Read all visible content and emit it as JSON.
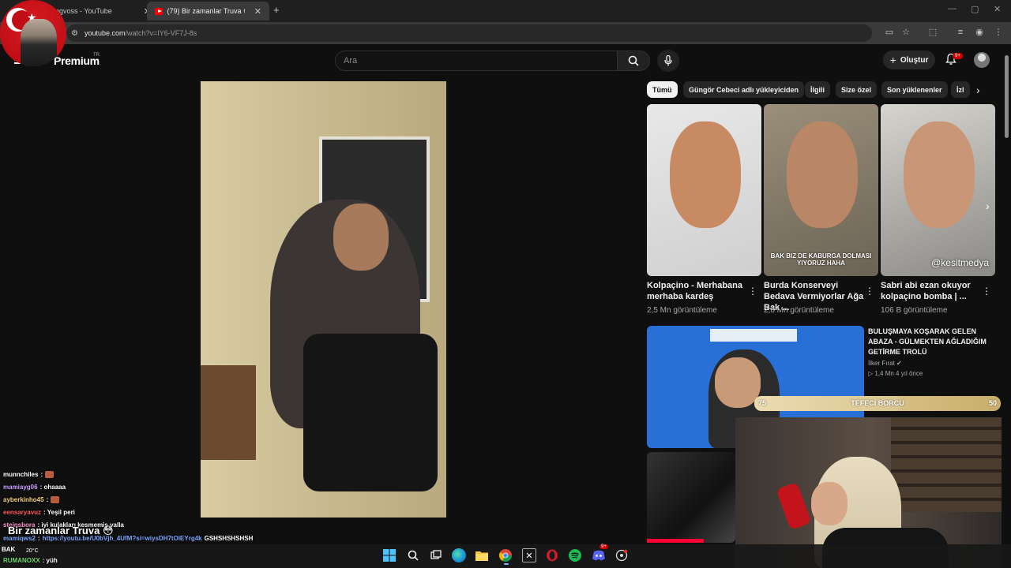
{
  "browser": {
    "tabs": [
      {
        "title": "ngvoss - YouTube",
        "active": false
      },
      {
        "title": "(79) Bir zamanlar Truva 😳 - Yo",
        "active": true
      }
    ],
    "new_tab": "+",
    "close": "✕",
    "window_controls": [
      "—",
      "▢",
      "✕"
    ],
    "url_host": "youtube.com",
    "url_path": "/watch?v=IY6-VF7J-8s"
  },
  "youtube": {
    "logo_text": "Premium",
    "logo_region": "TR",
    "search_placeholder": "Ara",
    "create_label": "Oluştur",
    "notification_badge": "9+"
  },
  "chips": [
    "Tümü",
    "Güngör Cebeci adlı yükleyiciden",
    "İlgili",
    "Size özel",
    "Son yüklenenler",
    "İzl"
  ],
  "shorts": [
    {
      "title": "Kolpaçino - Merhabana merhaba kardeş",
      "views": "2,5 Mn görüntüleme",
      "caption": "",
      "watermark": ""
    },
    {
      "title": "Burda Konserveyi Bedava Vermiyorlar Ağa Bak ...",
      "views": "2,8 Mn görüntüleme",
      "caption": "BAK BIZ DE KABURGA DOLMASI YIYORUZ HAHA",
      "watermark": ""
    },
    {
      "title": "Sabri abi ezan okuyor kolpaçino bomba | ...",
      "views": "106 B görüntüleme",
      "caption": "",
      "watermark": "@kesitmedya"
    }
  ],
  "recommendation": {
    "title": "BULUŞMAYA KOŞARAK GELEN ABAZA - GÜLMEKTEN AĞLADIĞIM GETİRME TROLÜ",
    "channel": "İlker Fırat",
    "meta": "1,4 Mn   4 yıl önce"
  },
  "stream_bar": {
    "left": "75",
    "label": "TEFECİ BORCU",
    "right": "50",
    "progress": 0.6
  },
  "chat": [
    {
      "user": "munnchiles",
      "user_color": "#ffffff",
      "message": "",
      "emote": true
    },
    {
      "user": "mamiayg06",
      "user_color": "#c9a0ff",
      "message": ": ohaaaa",
      "emote": false
    },
    {
      "user": "ayberkinho45",
      "user_color": "#f3d27a",
      "message": "",
      "emote": true
    },
    {
      "user": "eensaryavuz",
      "user_color": "#ff5a5a",
      "message": ": Yeşil peri",
      "emote": false
    },
    {
      "user": "steinsbora",
      "user_color": "#ff9ad5",
      "message": ": iyi kulakları kesmemiş valla",
      "emote": false
    },
    {
      "user": "mamiqws2",
      "user_color": "#7aa7ff",
      "message": "https://youtu.be/U0bVjh_4UfM?si=wiysDH7tOlEYrg4k",
      "extra": "GSHSHSHSHSH",
      "emote": false
    },
    {
      "user": "RUMANOXX",
      "user_color": "#6bd96b",
      "message": ": yüh",
      "emote": false
    }
  ],
  "overlay_title": "Bir zamanlar Truva 😳",
  "taskbar": {
    "weather_label": "BAK",
    "temperature": "20°C",
    "apps": [
      "windows-icon",
      "search-icon",
      "task-view-icon",
      "edge-icon",
      "file-explorer-icon",
      "chrome-icon",
      "x-icon",
      "opera-icon",
      "spotify-icon",
      "discord-icon",
      "app-icon"
    ],
    "discord_badge": "9+"
  }
}
